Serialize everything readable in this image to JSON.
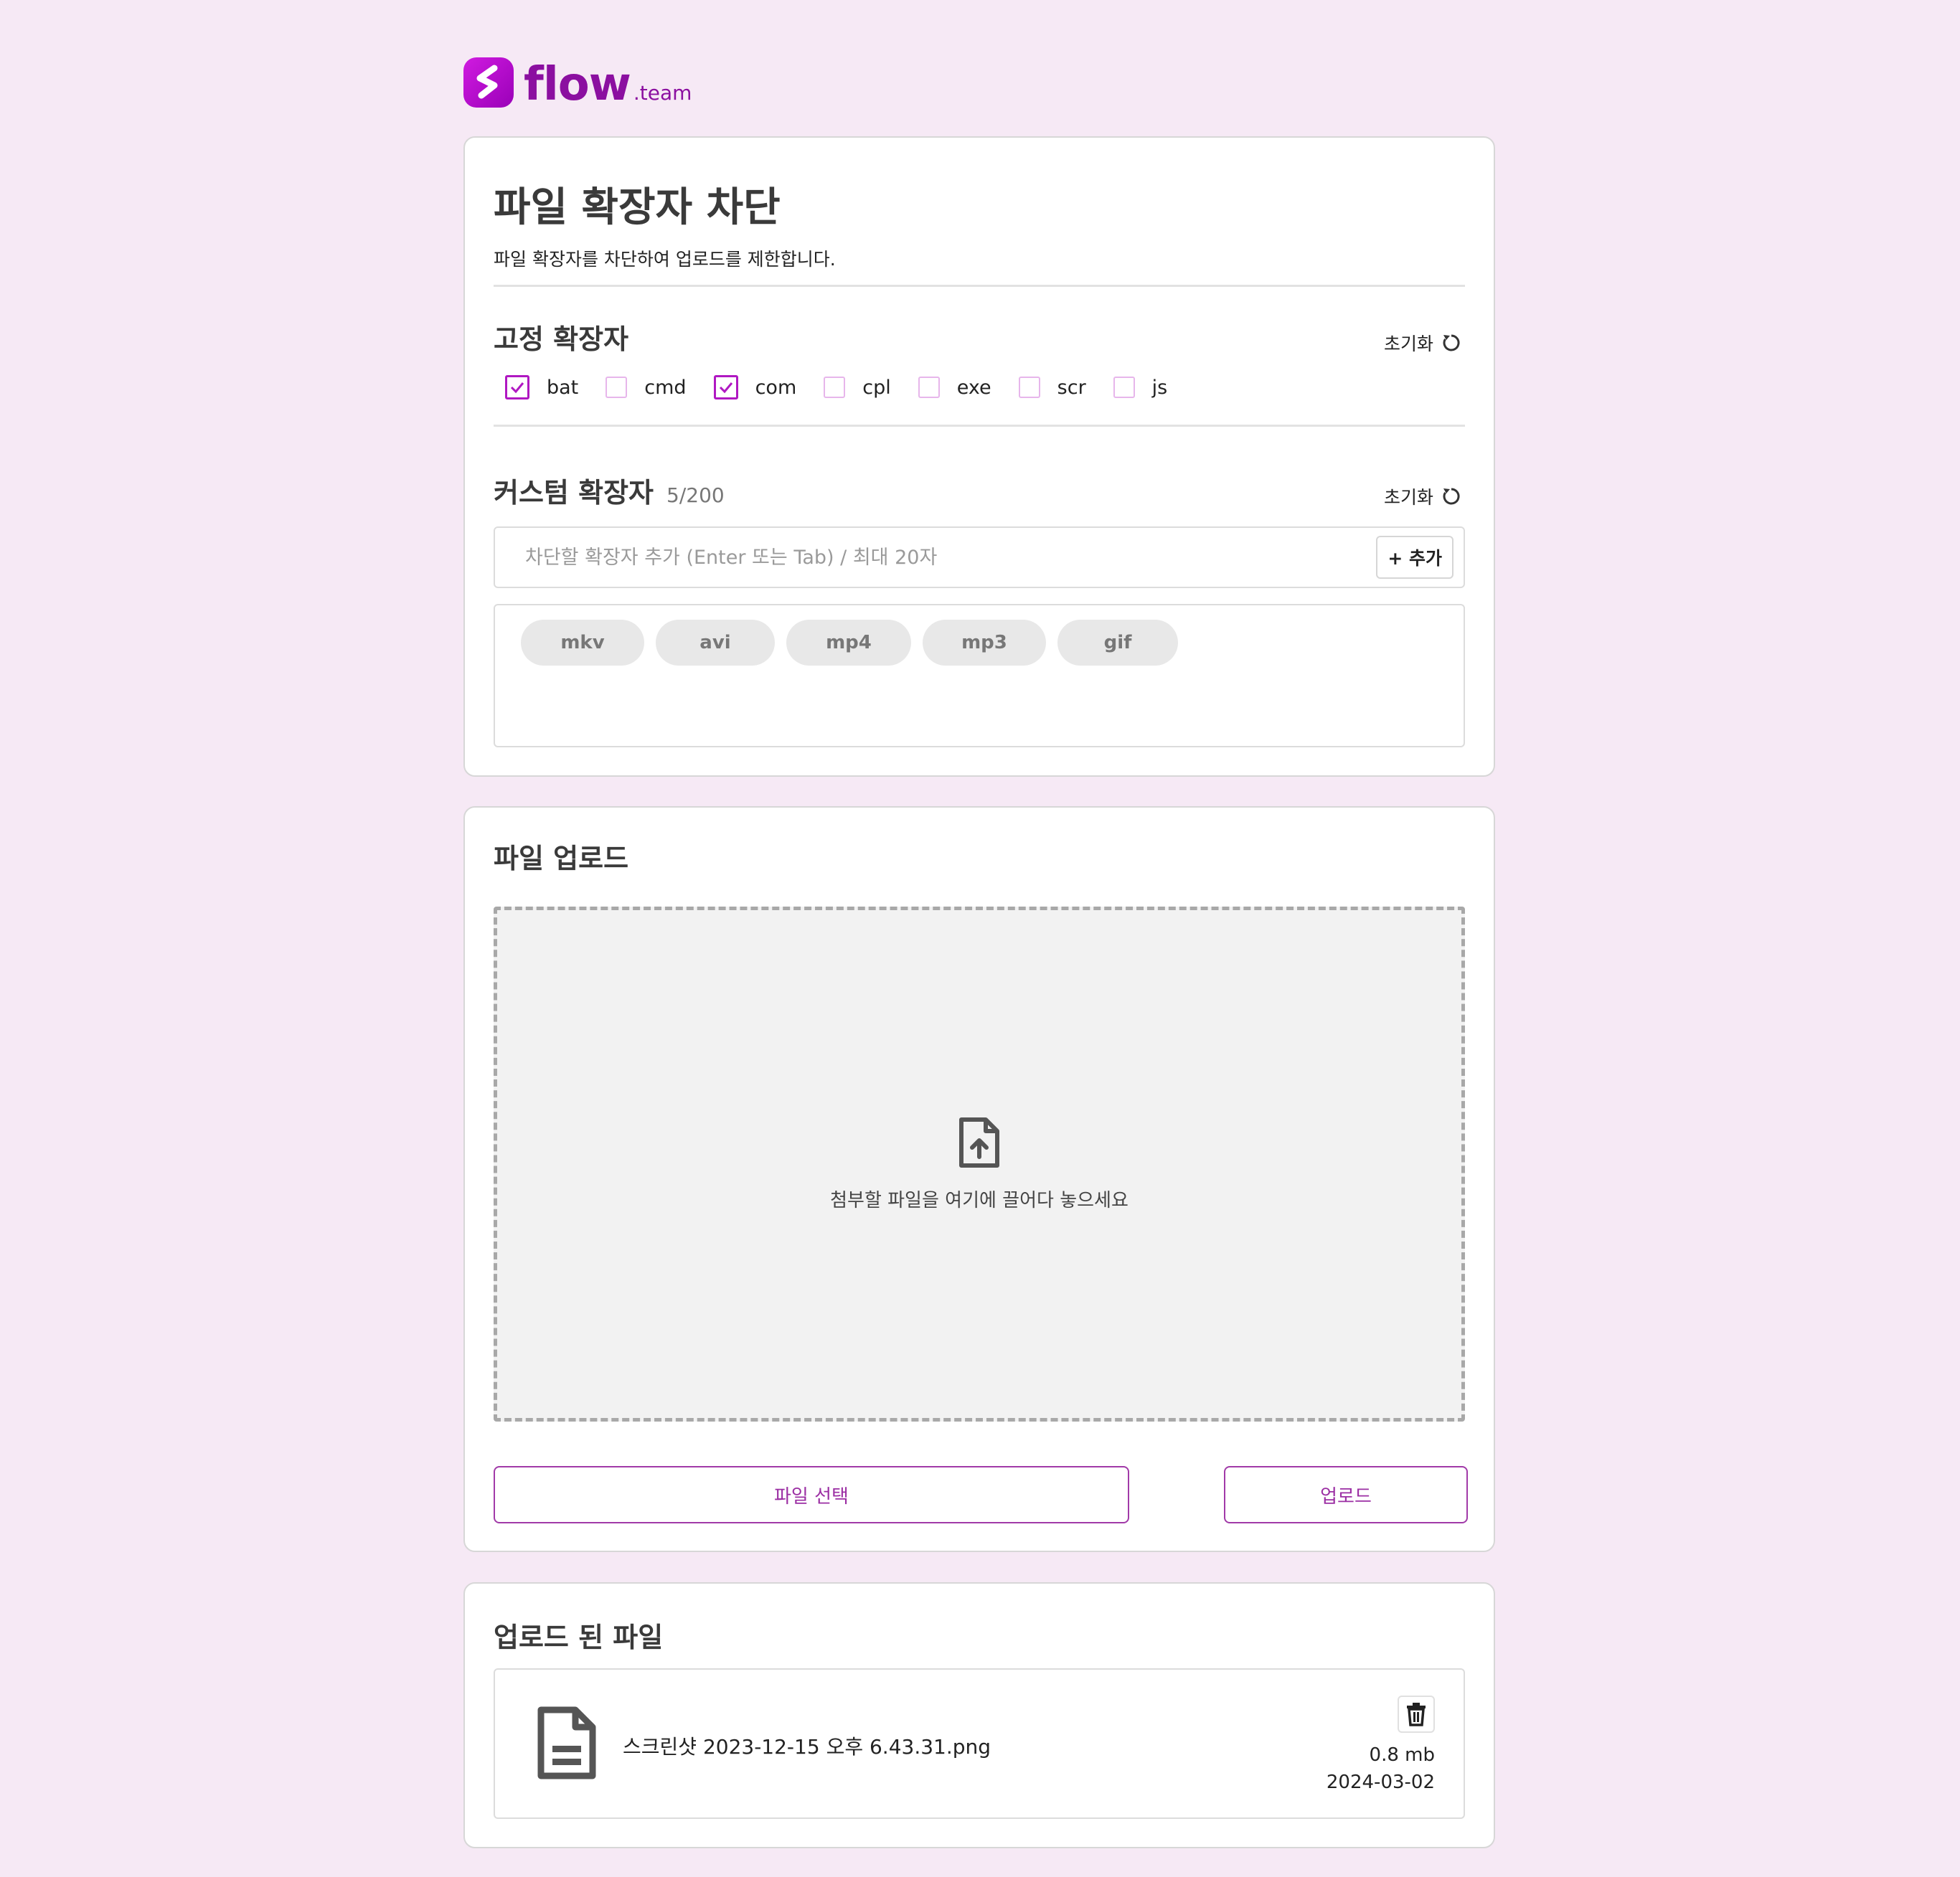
{
  "brand": {
    "name": "flow",
    "suffix": ".team",
    "color": "#8b0fa0"
  },
  "page": {
    "title": "파일 확장자 차단",
    "description": "파일 확장자를 차단하여 업로드를 제한합니다."
  },
  "fixed": {
    "heading": "고정 확장자",
    "reset_label": "초기화",
    "items": [
      {
        "label": "bat",
        "checked": true
      },
      {
        "label": "cmd",
        "checked": false
      },
      {
        "label": "com",
        "checked": true
      },
      {
        "label": "cpl",
        "checked": false
      },
      {
        "label": "exe",
        "checked": false
      },
      {
        "label": "scr",
        "checked": false
      },
      {
        "label": "js",
        "checked": false
      }
    ]
  },
  "custom": {
    "heading": "커스텀 확장자",
    "count": "5/200",
    "reset_label": "초기화",
    "placeholder": "차단할 확장자 추가 (Enter 또는 Tab) / 최대 20자",
    "add_label": "+ 추가",
    "tags": [
      "mkv",
      "avi",
      "mp4",
      "mp3",
      "gif"
    ]
  },
  "upload": {
    "heading": "파일 업로드",
    "drop_text": "첨부할 파일을 여기에 끌어다 놓으세요",
    "select_label": "파일 선택",
    "upload_label": "업로드"
  },
  "uploaded": {
    "heading": "업로드 된 파일",
    "files": [
      {
        "name": "스크린샷 2023-12-15 오후 6.43.31.png",
        "size": "0.8 mb",
        "date": "2024-03-02"
      }
    ]
  },
  "icons": {
    "reset": "refresh-icon",
    "upload": "file-upload-icon",
    "file": "file-document-icon",
    "delete": "trash-icon"
  },
  "colors": {
    "accent": "#b018c2",
    "background": "#f6e9f5"
  }
}
